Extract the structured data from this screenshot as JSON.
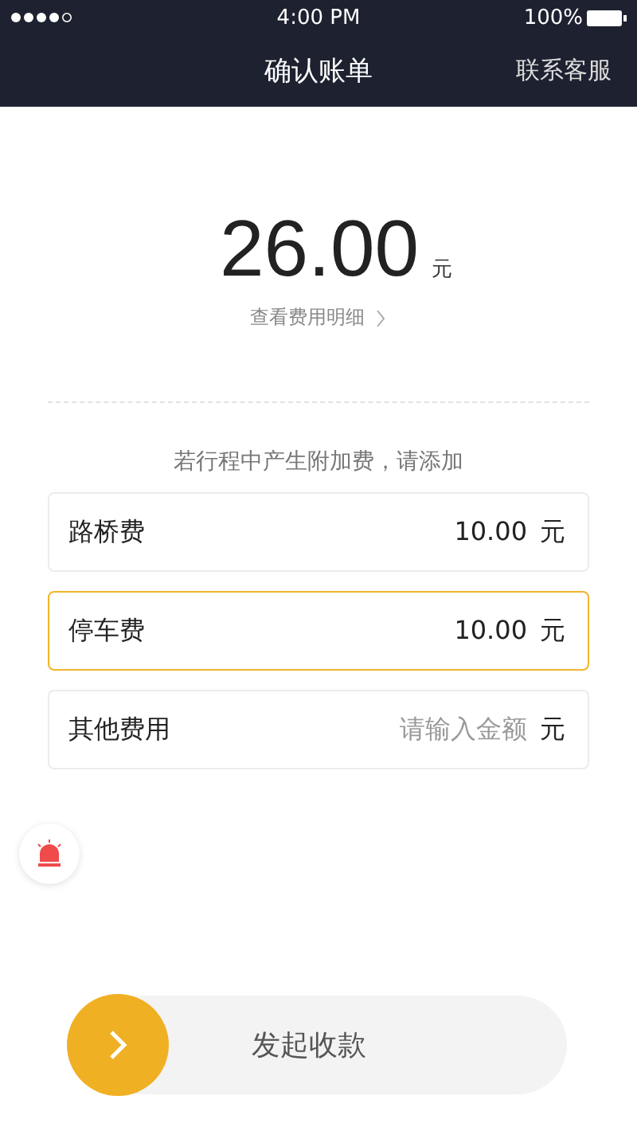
{
  "status_bar": {
    "time": "4:00 PM",
    "battery": "100%"
  },
  "nav": {
    "title": "确认账单",
    "action": "联系客服"
  },
  "amount": {
    "value": "26.00",
    "unit": "元",
    "detail_link": "查看费用明细"
  },
  "extra_note": "若行程中产生附加费，请添加",
  "fees": [
    {
      "label": "路桥费",
      "value": "10.00",
      "unit": "元",
      "selected": false
    },
    {
      "label": "停车费",
      "value": "10.00",
      "unit": "元",
      "selected": true
    },
    {
      "label": "其他费用",
      "placeholder": "请输入金额",
      "unit": "元",
      "selected": false
    }
  ],
  "collect_button": "发起收款"
}
